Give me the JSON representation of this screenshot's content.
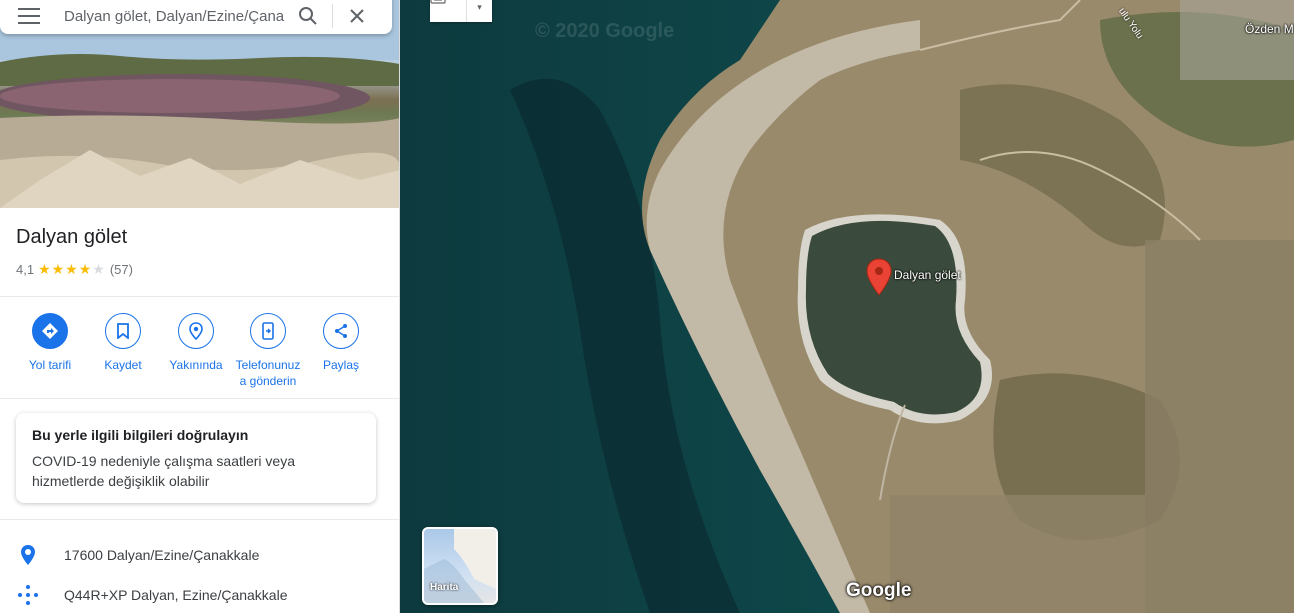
{
  "search": {
    "value": "Dalyan gölet, Dalyan/Ezine/Çanak",
    "icon": "search-icon",
    "close_icon": "close-icon"
  },
  "place": {
    "title": "Dalyan gölet",
    "rating": "4,1",
    "stars_filled": 4,
    "reviews": "(57)"
  },
  "actions": [
    {
      "label": "Yol tarifi",
      "icon": "directions-icon"
    },
    {
      "label": "Kaydet",
      "icon": "bookmark-icon"
    },
    {
      "label": "Yakınında",
      "icon": "nearby-icon"
    },
    {
      "label": "Telefonunuza gönderin",
      "label_line1": "Telefonunuz",
      "label_line2": "a gönderin",
      "icon": "send-to-phone-icon"
    },
    {
      "label": "Paylaş",
      "icon": "share-icon"
    }
  ],
  "notice": {
    "title": "Bu yerle ilgili bilgileri doğrulayın",
    "body": "COVID-19 nedeniyle çalışma saatleri veya hizmetlerde değişiklik olabilir"
  },
  "info": {
    "address": "17600 Dalyan/Ezine/Çanakkale",
    "plus_code": "Q44R+XP Dalyan, Ezine/Çanakkale"
  },
  "map": {
    "marker_label": "Dalyan gölet",
    "town_label": "Özden M",
    "road_label": "ulu Yolu",
    "watermark": "© 2020 Google",
    "layer_label": "Harita",
    "logo": "Google"
  },
  "colors": {
    "accent": "#1a73e8",
    "star": "#fbbc04",
    "marker": "#ea4335",
    "sea": "#0e3c40"
  }
}
